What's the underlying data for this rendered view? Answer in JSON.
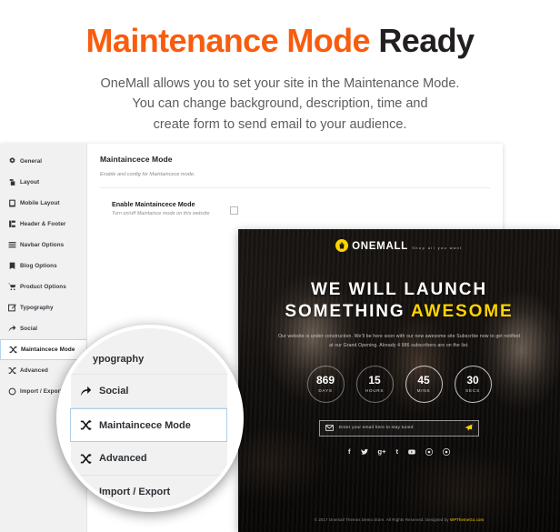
{
  "header": {
    "title_accent": "Maintenance Mode",
    "title_rest": "Ready",
    "subtitle_line1": "OneMall allows you to set your site in the Maintenance Mode.",
    "subtitle_line2": "You can change background, description, time and",
    "subtitle_line3": "create form to send email to your audience.",
    "accent_color": "#f95c0c",
    "dark_color": "#231f20"
  },
  "admin": {
    "sidebar": {
      "items": [
        {
          "label": "General",
          "icon": "gear-icon"
        },
        {
          "label": "Layout",
          "icon": "layers-icon"
        },
        {
          "label": "Mobile Layout",
          "icon": "mobile-icon"
        },
        {
          "label": "Header & Footer",
          "icon": "header-footer-icon"
        },
        {
          "label": "Navbar Options",
          "icon": "menu-bars-icon"
        },
        {
          "label": "Blog Options",
          "icon": "book-icon"
        },
        {
          "label": "Product Options",
          "icon": "cart-icon"
        },
        {
          "label": "Typography",
          "icon": "pencil-square-icon"
        },
        {
          "label": "Social",
          "icon": "share-arrow-icon"
        },
        {
          "label": "Maintaincece Mode",
          "icon": "shuffle-icon",
          "active": true
        },
        {
          "label": "Advanced",
          "icon": "shuffle-icon"
        },
        {
          "label": "Import / Export",
          "icon": "circle-icon"
        }
      ]
    },
    "panel": {
      "title": "Maintaincece Mode",
      "description": "Enable and config for Maintaincece mode.",
      "field_label": "Enable Maintaincece Mode",
      "field_sub": "Turn on/off Maintaince mode on this website",
      "checkbox_checked": false
    }
  },
  "magnifier": {
    "items": [
      {
        "label": "ypography",
        "icon": "pencil-square-icon",
        "partial": true
      },
      {
        "label": "Social",
        "icon": "share-arrow-icon"
      },
      {
        "label": "Maintaincece Mode",
        "icon": "shuffle-icon",
        "active": true
      },
      {
        "label": "Advanced",
        "icon": "shuffle-icon"
      },
      {
        "label": "Import / Export",
        "icon": "arrow-icon"
      }
    ]
  },
  "preview": {
    "logo_name": "ONEMALL",
    "logo_tagline": "Shop all you want",
    "headline_line1": "WE WILL LAUNCH",
    "headline_line2_plain": "SOMETHING ",
    "headline_line2_accent": "AWESOME",
    "description": "Our website is under construction. We'll be here soon with our new awesome site Subscribe now to get notified at our Grand Opening. Already 4 986 subscribers are on the list.",
    "countdown": [
      {
        "value": "869",
        "unit": "DAYS"
      },
      {
        "value": "15",
        "unit": "HOURS"
      },
      {
        "value": "45",
        "unit": "MINS"
      },
      {
        "value": "30",
        "unit": "SECS"
      }
    ],
    "email_placeholder": "Enter your email here to stay tuned",
    "social": [
      {
        "name": "facebook-icon",
        "glyph": "f"
      },
      {
        "name": "twitter-icon",
        "glyph": ""
      },
      {
        "name": "google-plus-icon",
        "glyph": "g+"
      },
      {
        "name": "tumblr-icon",
        "glyph": "t"
      },
      {
        "name": "youtube-icon",
        "glyph": ""
      },
      {
        "name": "pinterest-icon",
        "glyph": ""
      },
      {
        "name": "instagram-icon",
        "glyph": ""
      }
    ],
    "copyright_text": "© 2017 Onemall Themes Demo Store. All Rights Reserved. Designed by ",
    "copyright_link": "WPThemeGo.com",
    "accent_color": "#ffd400"
  }
}
